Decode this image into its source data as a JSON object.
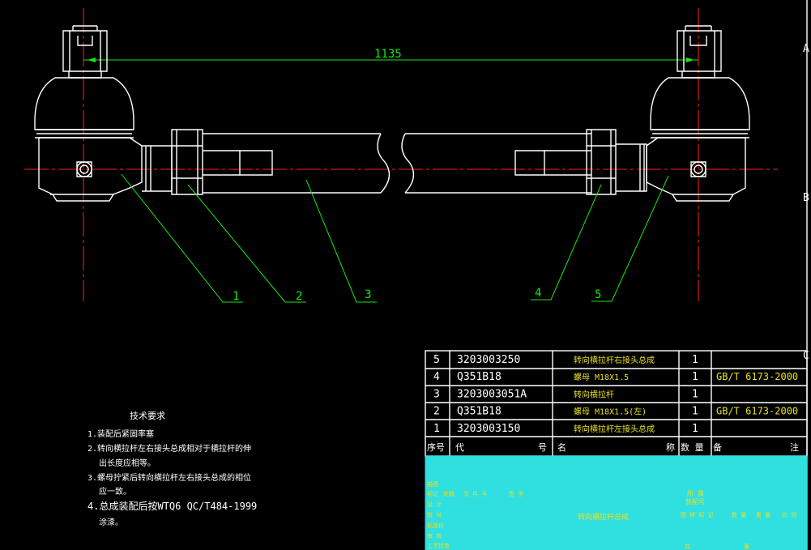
{
  "drawing": {
    "dimension_label": "1135",
    "side_marks": [
      "A",
      "B",
      "C"
    ],
    "balloons": [
      "1",
      "2",
      "3",
      "4",
      "5"
    ]
  },
  "tech_requirements": {
    "title": "技术要求",
    "items": [
      "1.装配后紧固率塞",
      "2.转向横拉杆左右接头总成相对于横拉杆的伸",
      "出长度应相等。",
      "3.螺母拧紧后转向横拉杆左右接头总成的相位",
      "应一致。",
      "4.总成装配后按WTQ6 QC/T484-1999",
      "涂漆。"
    ]
  },
  "parts_list": {
    "rows": [
      {
        "no": "5",
        "code": "3203003250",
        "name": "转向横拉杆右接头总成",
        "qty": "1",
        "note": ""
      },
      {
        "no": "4",
        "code": "Q351B18",
        "name": "螺母 M18X1.5",
        "qty": "1",
        "note": "GB/T 6173-2000"
      },
      {
        "no": "3",
        "code": "3203003051A",
        "name": "转向横拉杆",
        "qty": "1",
        "note": ""
      },
      {
        "no": "2",
        "code": "Q351B18",
        "name": "螺母 M18X1.5(左)",
        "qty": "1",
        "note": "GB/T 6173-2000"
      },
      {
        "no": "1",
        "code": "3203003150",
        "name": "转向横拉杆左接头总成",
        "qty": "1",
        "note": ""
      }
    ],
    "header": {
      "no": "序号",
      "code": "代",
      "code2": "号",
      "name": "名",
      "name2": "称",
      "qty": "数 量",
      "note": "备",
      "note2": "注"
    }
  },
  "title_block": {
    "drawing_name": "转向横拉杆总成",
    "labels": [
      "描图",
      "标记",
      "处数",
      "文 件 号",
      "签 字",
      "设 计",
      "校 对",
      "标准化",
      "审 核",
      "批 准",
      "工艺检查"
    ],
    "right_labels": [
      "所 属",
      "装配号",
      "图 样 标 记",
      "数 量",
      "重 量",
      "比 例",
      "共",
      "张",
      "第"
    ]
  },
  "colors": {
    "background": "#000000",
    "outline": "#ffffff",
    "center_line": "#ff2020",
    "leader": "#19e619",
    "dim_text": "#19e619"
  }
}
